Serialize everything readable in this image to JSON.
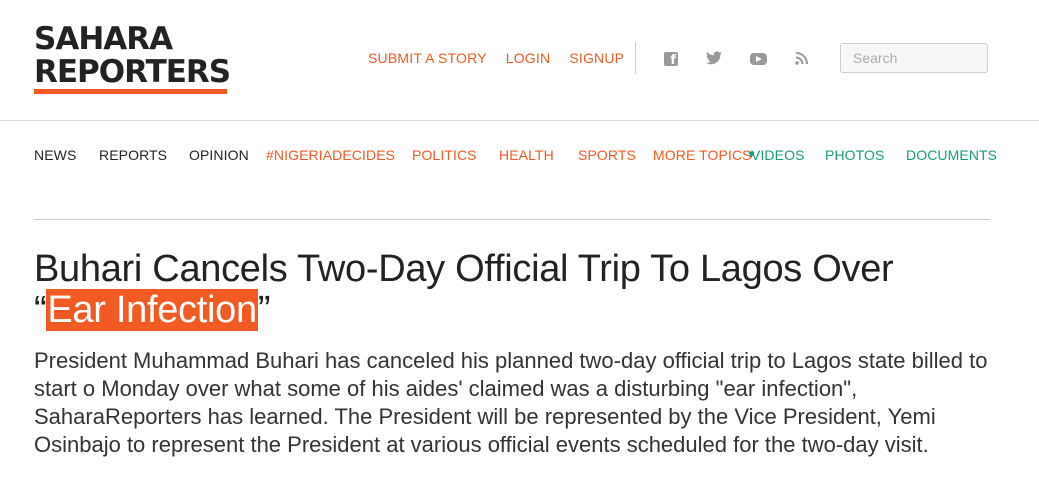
{
  "logo": {
    "line1": "SAHARA",
    "line2": "REPORTERS"
  },
  "top_links": [
    "SUBMIT A STORY",
    "LOGIN",
    "SIGNUP"
  ],
  "social_icons": [
    "facebook-icon",
    "twitter-icon",
    "youtube-icon",
    "rss-icon"
  ],
  "search": {
    "placeholder": "Search"
  },
  "nav": {
    "news": "NEWS",
    "reports": "REPORTS",
    "opinion": "OPINION",
    "nigeriadecides": "#NIGERIADECIDES",
    "politics": "POLITICS",
    "health": "HEALTH",
    "sports": "SPORTS",
    "more_topics": "MORE TOPICS",
    "videos": "VIDEOS",
    "photos": "PHOTOS",
    "documents": "DOCUMENTS"
  },
  "article": {
    "title_main": "Buhari Cancels Two-Day Official Trip To Lagos Over",
    "title_open_quote": "“",
    "title_highlight": "Ear Infection",
    "title_close_quote": "”",
    "lead": "President Muhammad Buhari has canceled his planned two-day official trip to Lagos state billed to start o Monday over what some of his aides' claimed was a disturbing \"ear infection\", SaharaReporters has learned. The President will be represented by the Vice President, Yemi Osinbajo to represent the President at various official events scheduled for the two-day visit."
  },
  "colors": {
    "accent": "#f15a22",
    "green": "#1a9a7a",
    "text": "#222222"
  }
}
